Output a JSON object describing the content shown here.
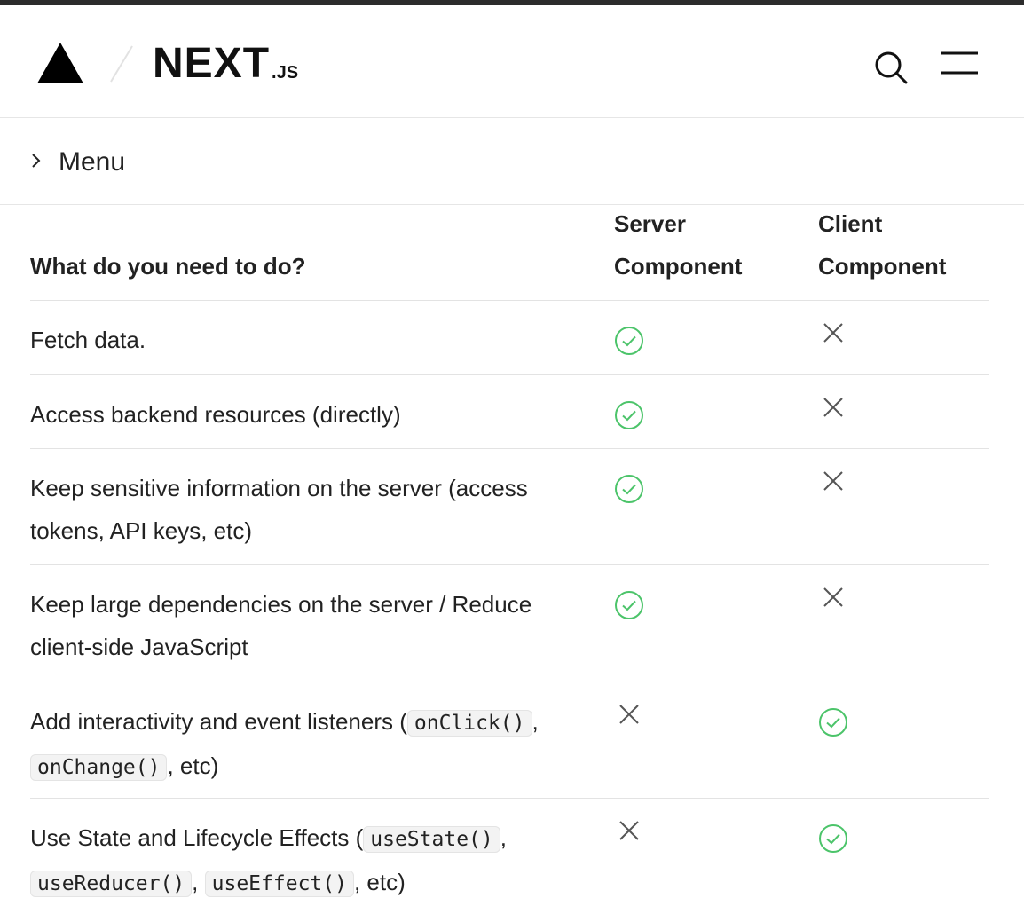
{
  "header": {
    "brand_main": "NEXT",
    "brand_sub": ".JS",
    "logo_icon": "vercel-triangle-icon",
    "search_icon": "search-icon",
    "menu_icon": "hamburger-icon"
  },
  "menu_bar": {
    "label": "Menu",
    "icon": "chevron-right-icon"
  },
  "table": {
    "headers": {
      "task": "What do you need to do?",
      "server_line1": "Server",
      "server_line2": "Component",
      "client_line1": "Client",
      "client_line2": "Component"
    },
    "rows": [
      {
        "task": "Fetch data.",
        "server": "check",
        "client": "cross"
      },
      {
        "task": "Access backend resources (directly)",
        "server": "check",
        "client": "cross"
      },
      {
        "task": "Keep sensitive information on the server (access tokens, API keys, etc)",
        "server": "check",
        "client": "cross"
      },
      {
        "task_line1": "Keep large dependencies on the server / Reduce",
        "task_line2": "client-side JavaScript",
        "server": "check",
        "client": "cross"
      },
      {
        "task_prefix": "Add interactivity and event listeners (",
        "code1": "onClick()",
        "sep1": ",",
        "code2": "onChange()",
        "suffix": ", etc)",
        "server": "cross",
        "client": "check"
      },
      {
        "task_prefix": "Use State and Lifecycle Effects (",
        "code1": "useState()",
        "sep1": ",",
        "code2": "useReducer()",
        "sep2": ",",
        "code3": "useEffect()",
        "suffix": ", etc)",
        "server": "cross",
        "client": "check"
      }
    ]
  },
  "colors": {
    "check": "#4cc46a",
    "cross": "#555555",
    "divider": "#e3e3e3"
  }
}
